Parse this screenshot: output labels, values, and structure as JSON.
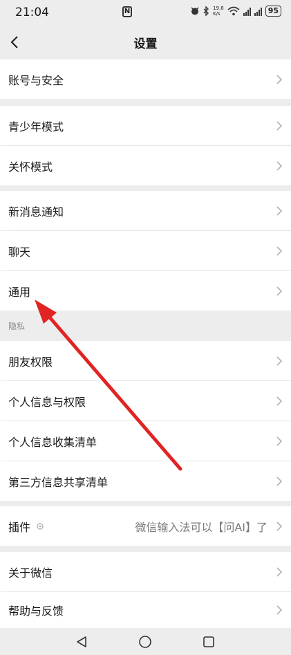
{
  "status_bar": {
    "time": "21:04",
    "nfc": "N",
    "speed_value": "19.8",
    "speed_unit": "K/s",
    "battery": "95"
  },
  "header": {
    "title": "设置",
    "back_icon": "chevron-left-icon"
  },
  "groups": [
    {
      "items": [
        {
          "label": "账号与安全"
        }
      ]
    },
    {
      "items": [
        {
          "label": "青少年模式"
        },
        {
          "label": "关怀模式"
        }
      ]
    },
    {
      "items": [
        {
          "label": "新消息通知"
        },
        {
          "label": "聊天"
        },
        {
          "label": "通用"
        }
      ]
    },
    {
      "header": "隐私",
      "items": [
        {
          "label": "朋友权限"
        },
        {
          "label": "个人信息与权限"
        },
        {
          "label": "个人信息收集清单"
        },
        {
          "label": "第三方信息共享清单"
        }
      ]
    },
    {
      "items": [
        {
          "label": "插件",
          "value": "微信输入法可以【问AI】了"
        }
      ]
    },
    {
      "items": [
        {
          "label": "关于微信"
        },
        {
          "label": "帮助与反馈"
        }
      ]
    }
  ],
  "annotation": {
    "arrow_color": "#e02424"
  },
  "system_nav": {
    "back": "triangle-back-icon",
    "home": "circle-home-icon",
    "recents": "square-recents-icon"
  }
}
